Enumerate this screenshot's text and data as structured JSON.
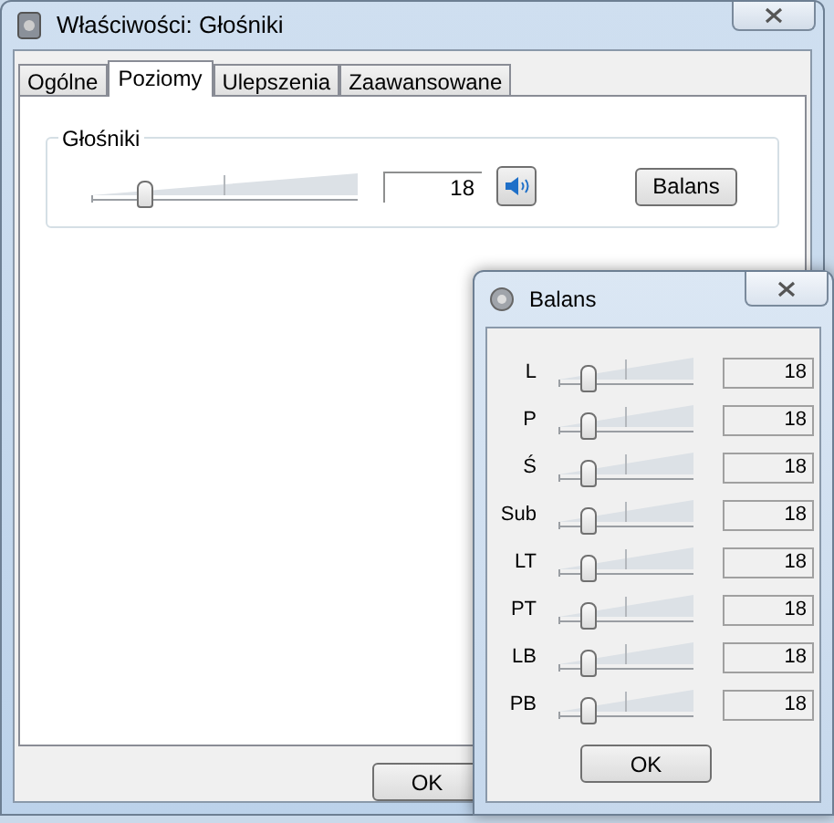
{
  "window": {
    "title": "Właściwości: Głośniki"
  },
  "tabs": [
    {
      "label": "Ogólne",
      "selected": false
    },
    {
      "label": "Poziomy",
      "selected": true
    },
    {
      "label": "Ulepszenia",
      "selected": false
    },
    {
      "label": "Zaawansowane",
      "selected": false
    }
  ],
  "levels": {
    "group_label": "Głośniki",
    "level": 0.18,
    "value": "18",
    "muted": false,
    "balance_button": "Balans"
  },
  "buttons": [
    "OK"
  ],
  "balance_dialog": {
    "title": "Balans",
    "channels": [
      {
        "name": "L",
        "level": 0.18,
        "value": "18"
      },
      {
        "name": "P",
        "level": 0.18,
        "value": "18"
      },
      {
        "name": "Ś",
        "level": 0.18,
        "value": "18"
      },
      {
        "name": "Sub",
        "level": 0.18,
        "value": "18"
      },
      {
        "name": "LT",
        "level": 0.18,
        "value": "18"
      },
      {
        "name": "PT",
        "level": 0.18,
        "value": "18"
      },
      {
        "name": "LB",
        "level": 0.18,
        "value": "18"
      },
      {
        "name": "PB",
        "level": 0.18,
        "value": "18"
      }
    ],
    "ok_button": "OK"
  }
}
